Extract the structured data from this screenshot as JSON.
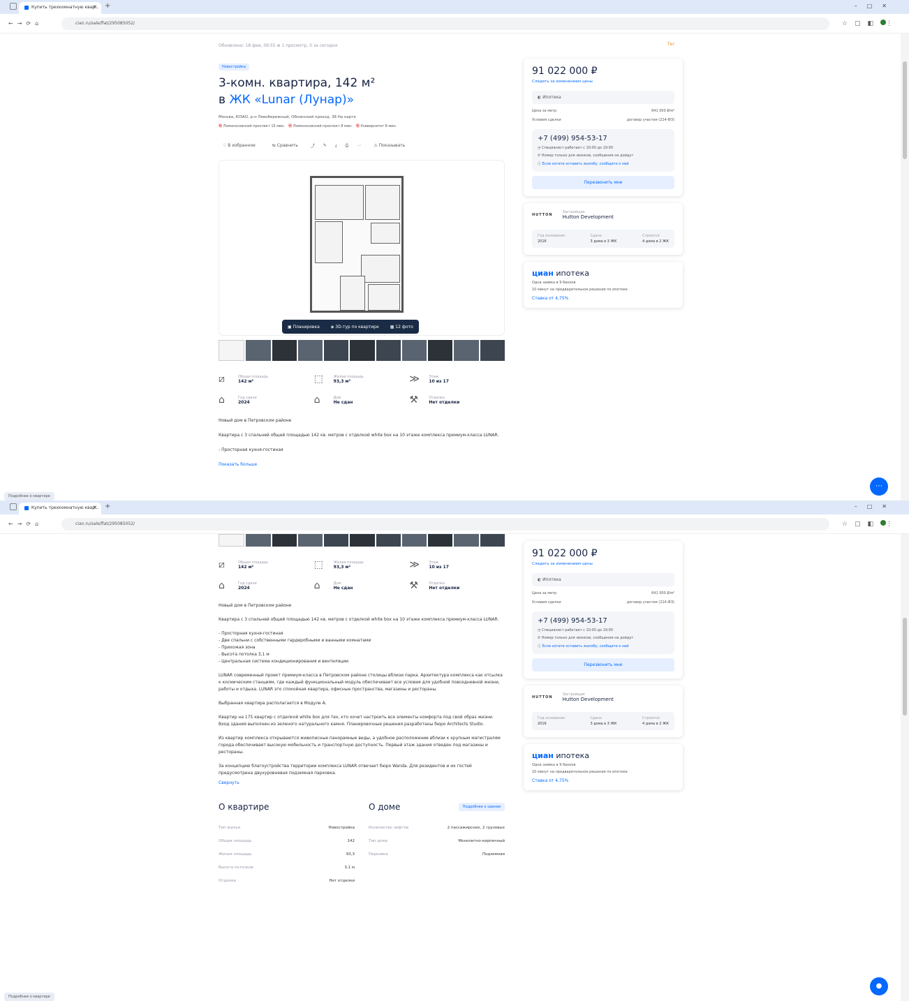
{
  "browser": {
    "tab_title": "Купить трехкомнатную квар...",
    "url": "cian.ru/sale/flat/295085052/",
    "status_text": "Подробнее о квартире"
  },
  "listing": {
    "meta": "Обновлено: 18 фев, 09:55   ⊕ 1 просмотр, 0 за сегодня",
    "report": "Тег",
    "badge": "Новостройка",
    "title": "3-комн. квартира, 142 м²",
    "title_prefix": "в",
    "complex_link": "ЖК «Lunar (Лунар)»",
    "address": "Москва, ЮЗАО, р-н Левобережный, Обнинский проезд, 38   На карте",
    "metro": [
      {
        "name": "Ломоносовский проспект",
        "time": "15 мин."
      },
      {
        "name": "Ломоносовский проспект",
        "time": "8 мин."
      },
      {
        "name": "Университет",
        "time": "8 мин."
      }
    ],
    "actions": [
      "В избранное",
      "Сравнить",
      "Показывать"
    ],
    "gallery_buttons": [
      "Планировка",
      "3D-тур по квартире",
      "12 фото"
    ],
    "features": [
      {
        "label": "Общая площадь",
        "value": "142 м²",
        "icon": "area-icon"
      },
      {
        "label": "Жилая площадь",
        "value": "93,3 м²",
        "icon": "living-area-icon"
      },
      {
        "label": "Этаж",
        "value": "10 из 17",
        "icon": "floor-icon"
      },
      {
        "label": "Год сдачи",
        "value": "2024",
        "icon": "building-icon"
      },
      {
        "label": "Дом",
        "value": "Не сдан",
        "icon": "house-icon"
      },
      {
        "label": "Отделка",
        "value": "Нет отделки",
        "icon": "finish-icon"
      }
    ],
    "desc_intro": "Новый дом в Петровском районе",
    "desc_p1": "Квартира с 3 спальней общей площадью 142 кв. метров с отделкой white box на 10 этаже комплекса премиум-класса LUNAR.",
    "desc_list": [
      "- Просторная кухня-гостиная",
      "- Две спальни с собственными гардеробными и ванными комнатами",
      "- Прихожая зона",
      "- Высота потолка 3,1 м",
      "- Центральная система кондиционирования и вентиляции"
    ],
    "desc_p2": "LUNAR современный проект премиум-класса в Петровском районе столицы вблизи парка. Архитектура комплекса как отсылка к космическим станциям, где каждый функциональный модуль обеспечивает все условия для удобной повседневной жизни, работы и отдыха. LUNAR это спокойная квартира, офисные пространства, магазины и рестораны.",
    "desc_p3": "Выбранная квартира располагается в Модуле А.",
    "desc_p4": "Квартир на 175 квартир с отделкой white box для тех, кто хочет настроить все элементы комфорта под свой образ жизни. Вход здания выполнен из зеленого натурального камня. Планировочные решения разработаны бюро Architects Studio.",
    "desc_p5": "Из квартир комплекса открываются живописные панорамные виды, а удобное расположение вблизи к крупным магистралям города обеспечивает высокую мобильность и транспортную доступность. Первый этаж здания отведен под магазины и рестораны.",
    "desc_p6": "За концепцию благоустройства территории комплекса LUNAR отвечает бюро Wanda. Для резидентов и их гостей предусмотрена двухуровневая подземная парковка.",
    "more_link": "Свернуть",
    "show_more_link": "Показать больше"
  },
  "sidebar": {
    "price": "91 022 000 ₽",
    "price_sub": "Следить за изменением цены",
    "notify": "Ипотека",
    "price_per_m_label": "Цена за метр",
    "price_per_m": "641 000 ₽/м²",
    "conditions_label": "Условия сделки",
    "conditions": "договор участия (214-ФЗ)",
    "phone": "+7 (499) 954-53-17",
    "phone_lines": [
      "Специалист работает с 10:00 до 19:00",
      "Номер только для звонков, сообщения не дойдут",
      "Если хотите оставить жалобу, сообщите о ней"
    ],
    "call_button": "Перезвонить мне",
    "dev_logo": "HUTTON",
    "dev_label": "Застройщик",
    "dev_name": "Hutton Development",
    "dev_stats": [
      {
        "k": "Год основания",
        "v": "2016"
      },
      {
        "k": "Сдано",
        "v": "3 дома в 3 ЖК"
      },
      {
        "k": "Строится",
        "v": "4 дома в 2 ЖК"
      }
    ],
    "mortgage_logo": "циан",
    "mortgage_title": "ипотека",
    "mortgage_lines": [
      "Одна заявка в 9 банков",
      "10 минут на предварительное решение по ипотеке"
    ],
    "mortgage_rate": "Ставка от 4,75%"
  },
  "about_flat": {
    "title": "О квартире",
    "rows": [
      {
        "k": "Тип жилья",
        "v": "Новостройка"
      },
      {
        "k": "Общая площадь",
        "v": "142"
      },
      {
        "k": "Жилая площадь",
        "v": "93,3"
      },
      {
        "k": "Высота потолков",
        "v": "3,1 м"
      },
      {
        "k": "Отделка",
        "v": "Нет отделки"
      }
    ]
  },
  "about_house": {
    "title": "О доме",
    "link": "Подробнее о здании",
    "rows": [
      {
        "k": "Количество лифтов",
        "v": "2 пассажирских, 2 грузовых"
      },
      {
        "k": "Тип дома",
        "v": "Монолитно-кирпичный"
      },
      {
        "k": "Парковка",
        "v": "Подземная"
      }
    ]
  }
}
